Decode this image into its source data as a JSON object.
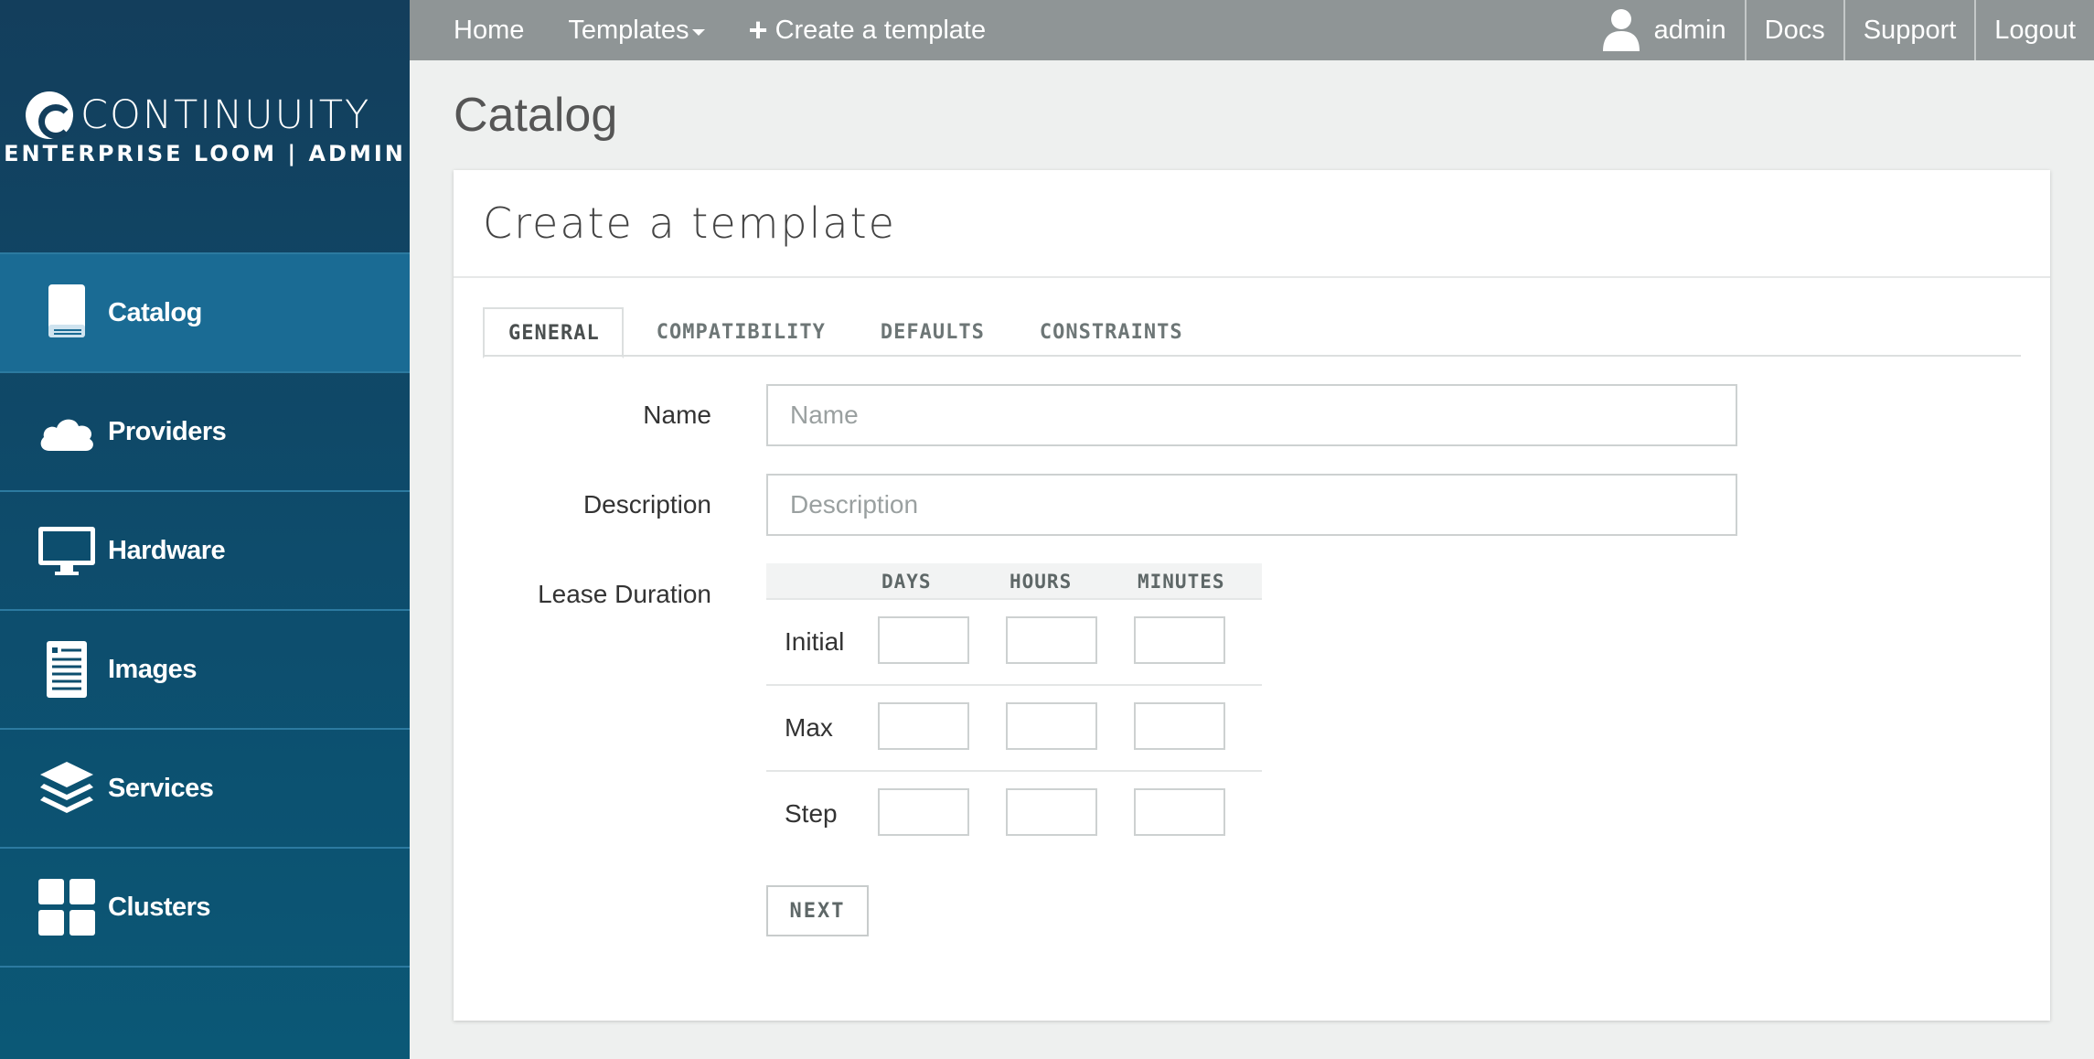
{
  "brand": {
    "name": "CONTINUUITY",
    "subtitle": "ENTERPRISE LOOM | ADMIN"
  },
  "sidebar": {
    "items": [
      {
        "label": "Catalog",
        "icon": "book-icon",
        "active": true
      },
      {
        "label": "Providers",
        "icon": "cloud-icon",
        "active": false
      },
      {
        "label": "Hardware",
        "icon": "monitor-icon",
        "active": false
      },
      {
        "label": "Images",
        "icon": "document-icon",
        "active": false
      },
      {
        "label": "Services",
        "icon": "layers-icon",
        "active": false
      },
      {
        "label": "Clusters",
        "icon": "grid-icon",
        "active": false
      }
    ]
  },
  "topbar": {
    "home": "Home",
    "templates": "Templates",
    "create": "Create a template",
    "user": "admin",
    "docs": "Docs",
    "support": "Support",
    "logout": "Logout"
  },
  "page": {
    "title": "Catalog"
  },
  "card": {
    "title": "Create a template",
    "tabs": [
      {
        "label": "GENERAL",
        "active": true
      },
      {
        "label": "COMPATIBILITY",
        "active": false
      },
      {
        "label": "DEFAULTS",
        "active": false
      },
      {
        "label": "CONSTRAINTS",
        "active": false
      }
    ]
  },
  "form": {
    "name_label": "Name",
    "name_placeholder": "Name",
    "name_value": "",
    "description_label": "Description",
    "description_placeholder": "Description",
    "description_value": "",
    "lease_label": "Lease Duration",
    "lease_columns": [
      "DAYS",
      "HOURS",
      "MINUTES"
    ],
    "lease_rows": [
      "Initial",
      "Max",
      "Step"
    ],
    "next_label": "NEXT"
  },
  "colors": {
    "sidebar_bg": "#133e5c",
    "sidebar_active": "#1a6b94",
    "topbar_bg": "#8f9596",
    "page_bg": "#eef0ef"
  }
}
